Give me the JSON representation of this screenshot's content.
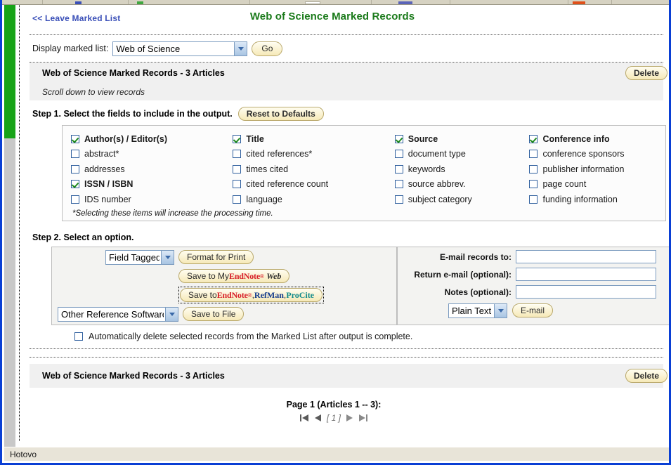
{
  "window": {
    "status_text": "Hotovo"
  },
  "header": {
    "leave_link": "<< Leave Marked List",
    "title": "Web of Science Marked Records"
  },
  "display_row": {
    "label": "Display marked list:",
    "selected": "Web of Science",
    "options": [
      "Web of Science"
    ],
    "go_label": "Go"
  },
  "records_bar": {
    "title": "Web of Science Marked Records - 3 Articles",
    "delete_label": "Delete",
    "scroll_note": "Scroll down to view records"
  },
  "step1": {
    "heading": "Step 1. Select the fields to include in the output.",
    "reset_label": "Reset to Defaults",
    "note": "*Selecting these items will increase the processing time.",
    "columns": [
      [
        {
          "label": "Author(s) / Editor(s)",
          "checked": true,
          "bold": true
        },
        {
          "label": "abstract*",
          "checked": false,
          "bold": false
        },
        {
          "label": "addresses",
          "checked": false,
          "bold": false
        },
        {
          "label": "ISSN / ISBN",
          "checked": true,
          "bold": true
        },
        {
          "label": "IDS number",
          "checked": false,
          "bold": false
        }
      ],
      [
        {
          "label": "Title",
          "checked": true,
          "bold": true
        },
        {
          "label": "cited references*",
          "checked": false,
          "bold": false
        },
        {
          "label": "times cited",
          "checked": false,
          "bold": false
        },
        {
          "label": "cited reference count",
          "checked": false,
          "bold": false
        },
        {
          "label": "language",
          "checked": false,
          "bold": false
        }
      ],
      [
        {
          "label": "Source",
          "checked": true,
          "bold": true
        },
        {
          "label": "document type",
          "checked": false,
          "bold": false
        },
        {
          "label": "keywords",
          "checked": false,
          "bold": false
        },
        {
          "label": "source abbrev.",
          "checked": false,
          "bold": false
        },
        {
          "label": "subject category",
          "checked": false,
          "bold": false
        }
      ],
      [
        {
          "label": "Conference info",
          "checked": true,
          "bold": true
        },
        {
          "label": "conference sponsors",
          "checked": false,
          "bold": false
        },
        {
          "label": "publisher information",
          "checked": false,
          "bold": false
        },
        {
          "label": "page count",
          "checked": false,
          "bold": false
        },
        {
          "label": "funding information",
          "checked": false,
          "bold": false
        }
      ]
    ]
  },
  "step2": {
    "heading": "Step 2. Select an option.",
    "format_select": {
      "selected": "Field Tagged",
      "options": [
        "Field Tagged"
      ]
    },
    "format_print_label": "Format for Print",
    "save_endnote_web": {
      "prefix": "Save to My ",
      "brand": "EndNote",
      "brand_suffix": "Web"
    },
    "save_endnote_refman_procite": {
      "prefix": "Save to ",
      "endnote": "EndNote",
      "sep1": ", ",
      "refman": "RefMan",
      "sep2": ", ",
      "procite": "ProCite"
    },
    "other_software_select": {
      "selected": "Other Reference Software",
      "options": [
        "Other Reference Software"
      ]
    },
    "save_to_file_label": "Save to File",
    "email": {
      "to_label": "E-mail records to:",
      "to_value": "",
      "return_label": "Return e-mail (optional):",
      "return_value": "",
      "notes_label": "Notes (optional):",
      "notes_value": "",
      "format_select": {
        "selected": "Plain Text",
        "options": [
          "Plain Text"
        ]
      },
      "email_button_label": "E-mail"
    }
  },
  "auto_delete": {
    "label": "Automatically delete selected records from the Marked List after output is complete.",
    "checked": false
  },
  "bottom": {
    "records_title": "Web of Science Marked Records - 3 Articles",
    "delete_label": "Delete",
    "pager_text": "Page 1 (Articles 1 -- 3):",
    "current_page": "[ 1 ]"
  },
  "colors": {
    "title_green": "#1a7a1a",
    "link_blue": "#3a4fb8",
    "rail_green": "#17a317",
    "pill_yellow": "#f6e9b8",
    "endnote_red": "#d8202a",
    "refman_blue": "#123a8c",
    "procite_teal": "#0f8a8a"
  }
}
